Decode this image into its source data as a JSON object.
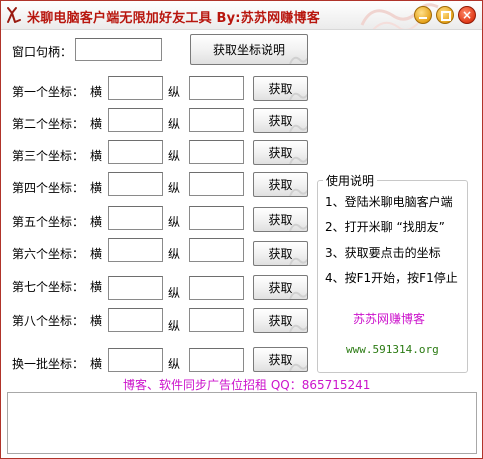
{
  "window": {
    "title": "米聊电脑客户端无限加好友工具 By:苏苏网赚博客"
  },
  "handle": {
    "label": "窗口句柄：",
    "value": "",
    "help_button": "获取坐标说明"
  },
  "coords": {
    "h_label": "横",
    "v_label": "纵",
    "get_label": "获取",
    "rows": [
      {
        "label": "第一个坐标：",
        "x": "",
        "y": ""
      },
      {
        "label": "第二个坐标：",
        "x": "",
        "y": ""
      },
      {
        "label": "第三个坐标：",
        "x": "",
        "y": ""
      },
      {
        "label": "第四个坐标：",
        "x": "",
        "y": ""
      },
      {
        "label": "第五个坐标：",
        "x": "",
        "y": ""
      },
      {
        "label": "第六个坐标：",
        "x": "",
        "y": ""
      },
      {
        "label": "第七个坐标：",
        "x": "",
        "y": ""
      },
      {
        "label": "第八个坐标：",
        "x": "",
        "y": ""
      },
      {
        "label": "换一批坐标：",
        "x": "",
        "y": ""
      }
    ]
  },
  "instructions": {
    "title": "使用说明",
    "steps": [
      "1、登陆米聊电脑客户端",
      "2、打开米聊 “找朋友”",
      "3、获取要点击的坐标",
      "4、按F1开始，按F1停止"
    ],
    "blog_name": "苏苏网赚博客",
    "blog_url": "www.591314.org"
  },
  "footer": {
    "ad_text": "博客、软件同步广告位招租  QQ：865715241",
    "log": ""
  },
  "colors": {
    "title": "#b8160e",
    "blog": "#cc14cc",
    "url": "#2a7a12",
    "close": "#e03a18",
    "minmax": "#e5a21a"
  }
}
